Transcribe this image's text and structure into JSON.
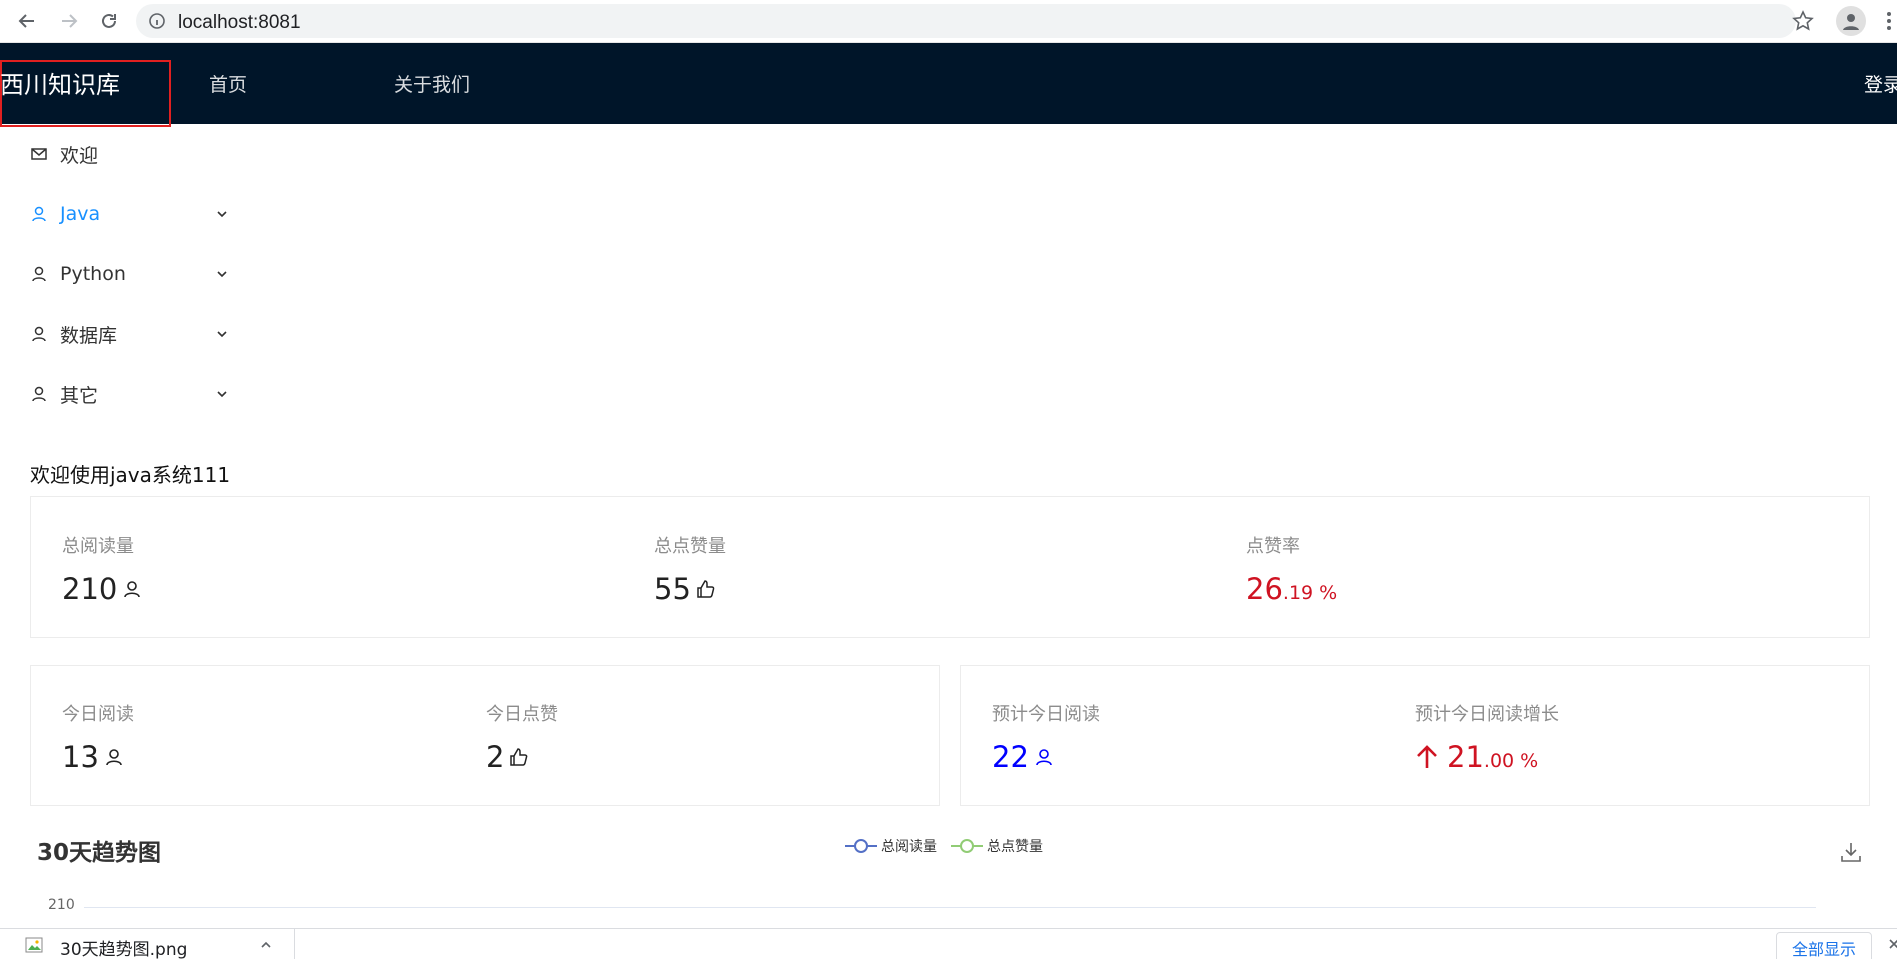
{
  "browser": {
    "url": "localhost:8081"
  },
  "header": {
    "logo": "西川知识库",
    "nav": [
      "首页",
      "关于我们"
    ],
    "login": "登录"
  },
  "sidebar": {
    "items": [
      {
        "label": "欢迎",
        "icon": "mail-icon",
        "expandable": false,
        "active": false
      },
      {
        "label": "Java",
        "icon": "user-icon",
        "expandable": true,
        "active": true
      },
      {
        "label": "Python",
        "icon": "user-icon",
        "expandable": true,
        "active": false
      },
      {
        "label": "数据库",
        "icon": "user-icon",
        "expandable": true,
        "active": false
      },
      {
        "label": "其它",
        "icon": "user-icon",
        "expandable": true,
        "active": false
      }
    ]
  },
  "welcome": "欢迎使用java系统111",
  "stats_total": [
    {
      "title": "总阅读量",
      "value": "210",
      "icon": "user-icon"
    },
    {
      "title": "总点赞量",
      "value": "55",
      "icon": "like-icon"
    },
    {
      "title": "点赞率",
      "value_int": "26",
      "value_dec": ".19 %",
      "color": "#cf1322"
    }
  ],
  "stats_today": [
    {
      "title": "今日阅读",
      "value": "13",
      "icon": "user-icon"
    },
    {
      "title": "今日点赞",
      "value": "2",
      "icon": "like-icon"
    }
  ],
  "stats_forecast": [
    {
      "title": "预计今日阅读",
      "value": "22",
      "icon": "user-icon",
      "color": "#0000ff"
    },
    {
      "title": "预计今日阅读增长",
      "value_int": "21",
      "value_dec": ".00 %",
      "icon": "arrow-up-icon",
      "color": "#cf1322"
    }
  ],
  "chart": {
    "title": "30天趋势图",
    "legend": [
      {
        "name": "总阅读量",
        "color": "#5470c6"
      },
      {
        "name": "总点赞量",
        "color": "#91cc75"
      }
    ],
    "y_tick_top": "210"
  },
  "download_shelf": {
    "file_name": "30天趋势图.png",
    "show_all": "全部显示"
  }
}
